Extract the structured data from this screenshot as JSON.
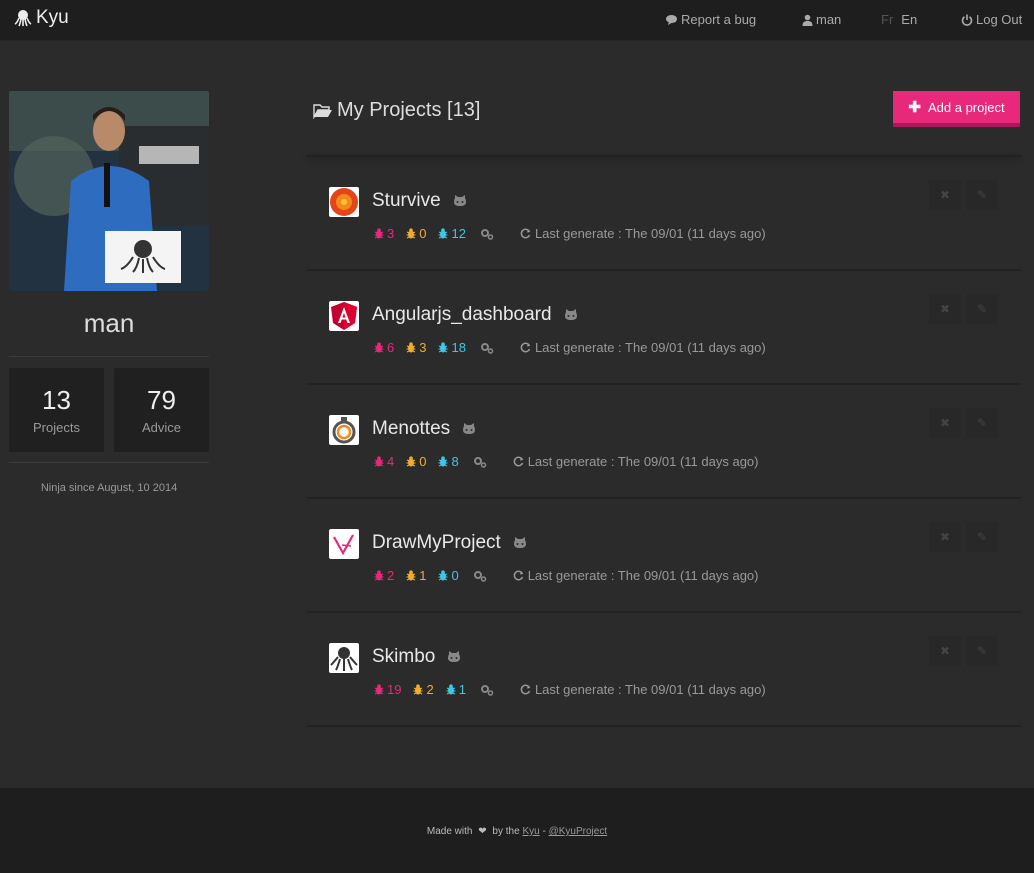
{
  "nav": {
    "brand": "Kyu",
    "report_bug": "Report a bug",
    "user": "man",
    "lang_fr": "Fr",
    "lang_en": "En",
    "logout": "Log Out"
  },
  "profile": {
    "name": "man",
    "projects_count": "13",
    "projects_label": "Projects",
    "advice_count": "79",
    "advice_label": "Advice",
    "since": "Ninja since August, 10 2014"
  },
  "main": {
    "title": "My Projects [13]",
    "add_button": "Add a project"
  },
  "projects": [
    {
      "name": "Sturvive",
      "bugs_pink": "3",
      "bugs_orange": "0",
      "bugs_cyan": "12",
      "last_generate": "Last generate : The 09/01 (11 days ago)"
    },
    {
      "name": "Angularjs_dashboard",
      "bugs_pink": "6",
      "bugs_orange": "3",
      "bugs_cyan": "18",
      "last_generate": "Last generate : The 09/01 (11 days ago)"
    },
    {
      "name": "Menottes",
      "bugs_pink": "4",
      "bugs_orange": "0",
      "bugs_cyan": "8",
      "last_generate": "Last generate : The 09/01 (11 days ago)"
    },
    {
      "name": "DrawMyProject",
      "bugs_pink": "2",
      "bugs_orange": "1",
      "bugs_cyan": "0",
      "last_generate": "Last generate : The 09/01 (11 days ago)"
    },
    {
      "name": "Skimbo",
      "bugs_pink": "19",
      "bugs_orange": "2",
      "bugs_cyan": "1",
      "last_generate": "Last generate : The 09/01 (11 days ago)"
    }
  ],
  "footer": {
    "made_with": "Made with",
    "by_the": "by the",
    "kyu_link": "Kyu",
    "separator": "-",
    "handle_link": "@KyuProject"
  },
  "colors": {
    "accent": "#e8287a",
    "bug_pink": "#e8287a",
    "bug_orange": "#f0ad2d",
    "bug_cyan": "#3cc8e6"
  }
}
